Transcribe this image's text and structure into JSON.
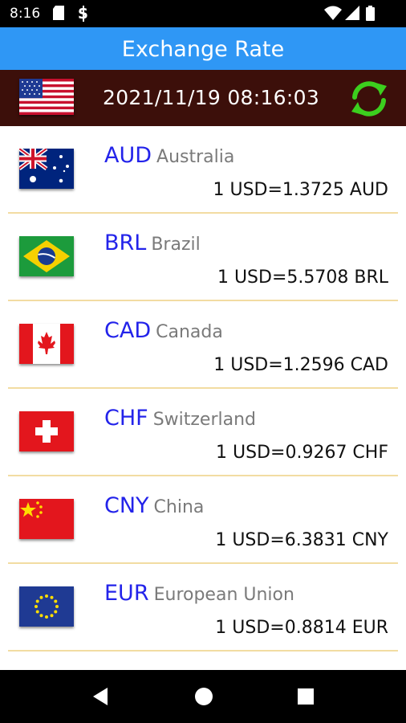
{
  "status_bar": {
    "time": "8:16",
    "icons": [
      "sd-card-icon",
      "sync-icon",
      "wifi-icon",
      "signal-icon",
      "battery-icon"
    ]
  },
  "app": {
    "title": "Exchange Rate",
    "base_flag": "flag-us",
    "datetime": "2021/11/19 08:16:03",
    "refresh_icon": "refresh-icon",
    "accent_color": "#2f97f5",
    "header_color": "#3c0f0a",
    "code_color": "#2323ea"
  },
  "rates": [
    {
      "code": "AUD",
      "country": "Australia",
      "rate": "1 USD=1.3725 AUD",
      "flag": "flag-au"
    },
    {
      "code": "BRL",
      "country": "Brazil",
      "rate": "1 USD=5.5708 BRL",
      "flag": "flag-br"
    },
    {
      "code": "CAD",
      "country": "Canada",
      "rate": "1 USD=1.2596 CAD",
      "flag": "flag-ca"
    },
    {
      "code": "CHF",
      "country": "Switzerland",
      "rate": "1 USD=0.9267 CHF",
      "flag": "flag-ch"
    },
    {
      "code": "CNY",
      "country": "China",
      "rate": "1 USD=6.3831 CNY",
      "flag": "flag-cn"
    },
    {
      "code": "EUR",
      "country": "European Union",
      "rate": "1 USD=0.8814 EUR",
      "flag": "flag-eu"
    }
  ],
  "nav_bar": {
    "buttons": [
      "back-icon",
      "home-icon",
      "recents-icon"
    ]
  }
}
